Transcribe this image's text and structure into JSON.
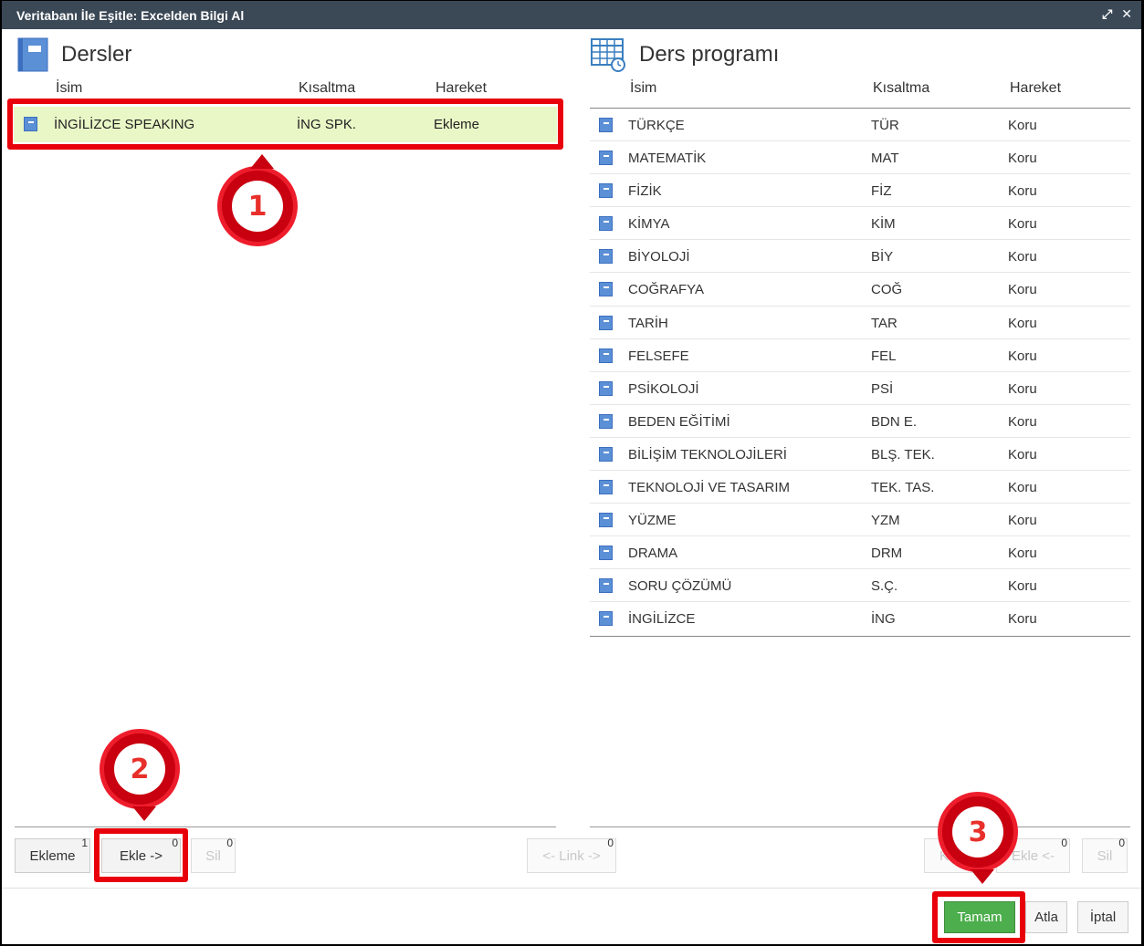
{
  "window": {
    "title": "Veritabanı İle Eşitle: Excelden Bilgi Al",
    "actions": [
      "⤢",
      "✕"
    ]
  },
  "left_panel": {
    "title": "Dersler",
    "columns": [
      "İsim",
      "Kısaltma",
      "Hareket"
    ],
    "rows": [
      {
        "name": "İNGİLİZCE SPEAKING",
        "abbr": "İNG SPK.",
        "action": "Ekleme"
      }
    ],
    "buttons": {
      "ekleme": "Ekleme",
      "ekleme_count": "1",
      "ekle": "Ekle ->",
      "ekle_count": "0",
      "sil": "Sil",
      "sil_count": "0"
    }
  },
  "middle": {
    "link": "<- Link ->",
    "link_count": "0"
  },
  "right_panel": {
    "title": "Ders programı",
    "columns": [
      "İsim",
      "Kısaltma",
      "Hareket"
    ],
    "rows": [
      {
        "name": "TÜRKÇE",
        "abbr": "TÜR",
        "action": "Koru"
      },
      {
        "name": "MATEMATİK",
        "abbr": "MAT",
        "action": "Koru"
      },
      {
        "name": "FİZİK",
        "abbr": "FİZ",
        "action": "Koru"
      },
      {
        "name": "KİMYA",
        "abbr": "KİM",
        "action": "Koru"
      },
      {
        "name": "BİYOLOJİ",
        "abbr": "BİY",
        "action": "Koru"
      },
      {
        "name": "COĞRAFYA",
        "abbr": "COĞ",
        "action": "Koru"
      },
      {
        "name": "TARİH",
        "abbr": "TAR",
        "action": "Koru"
      },
      {
        "name": "FELSEFE",
        "abbr": "FEL",
        "action": "Koru"
      },
      {
        "name": "PSİKOLOJİ",
        "abbr": "PSİ",
        "action": "Koru"
      },
      {
        "name": "BEDEN EĞİTİMİ",
        "abbr": "BDN E.",
        "action": "Koru"
      },
      {
        "name": "BİLİŞİM TEKNOLOJİLERİ",
        "abbr": "BLŞ. TEK.",
        "action": "Koru"
      },
      {
        "name": "TEKNOLOJİ VE TASARIM",
        "abbr": "TEK. TAS.",
        "action": "Koru"
      },
      {
        "name": "YÜZME",
        "abbr": "YZM",
        "action": "Koru"
      },
      {
        "name": "DRAMA",
        "abbr": "DRM",
        "action": "Koru"
      },
      {
        "name": "SORU ÇÖZÜMÜ",
        "abbr": "S.Ç.",
        "action": "Koru"
      },
      {
        "name": "İNGİLİZCE",
        "abbr": "İNG",
        "action": "Koru"
      }
    ],
    "buttons": {
      "koru": "K",
      "koru_count": "",
      "ekle": "Ekle <-",
      "ekle_count": "0",
      "sil": "Sil",
      "sil_count": "0"
    }
  },
  "footer": {
    "ok": "Tamam",
    "skip": "Atla",
    "cancel": "İptal"
  },
  "markers": [
    "1",
    "2",
    "3"
  ],
  "colors": {
    "accent_red": "#e8000b",
    "ok_green": "#4cae4c",
    "titlebar": "#3b4856"
  }
}
